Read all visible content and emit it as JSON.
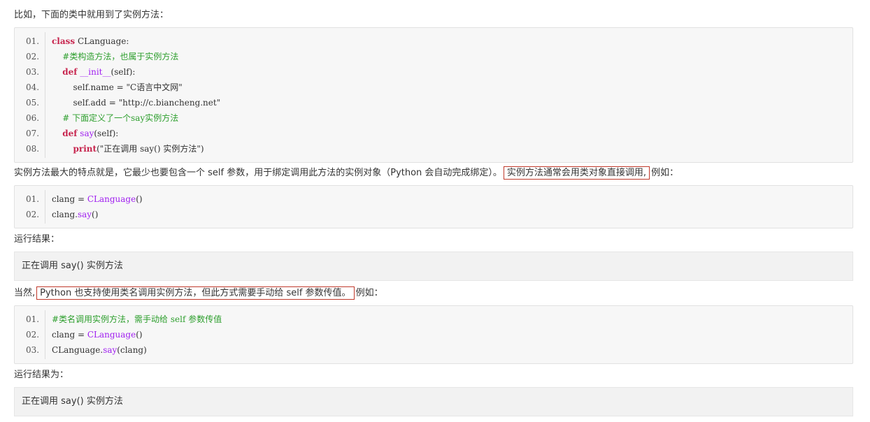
{
  "intro": "比如，下面的类中就用到了实例方法：",
  "code1": {
    "lines": [
      {
        "n": "01.",
        "parts": [
          [
            "kw",
            "class"
          ],
          [
            "plain",
            " CLanguage:"
          ]
        ]
      },
      {
        "n": "02.",
        "parts": [
          [
            "plain",
            "    "
          ],
          [
            "cm",
            "#类构造方法，也属于实例方法"
          ]
        ]
      },
      {
        "n": "03.",
        "parts": [
          [
            "plain",
            "    "
          ],
          [
            "kw",
            "def"
          ],
          [
            "plain",
            " "
          ],
          [
            "fn",
            "__init__"
          ],
          [
            "plain",
            "(self):"
          ]
        ]
      },
      {
        "n": "04.",
        "parts": [
          [
            "plain",
            "        self.name = \"C语言中文网\""
          ]
        ]
      },
      {
        "n": "05.",
        "parts": [
          [
            "plain",
            "        self.add = \"http://c.biancheng.net\""
          ]
        ]
      },
      {
        "n": "06.",
        "parts": [
          [
            "plain",
            "    "
          ],
          [
            "cm",
            "# 下面定义了一个say实例方法"
          ]
        ]
      },
      {
        "n": "07.",
        "parts": [
          [
            "plain",
            "    "
          ],
          [
            "kw",
            "def"
          ],
          [
            "plain",
            " "
          ],
          [
            "fn",
            "say"
          ],
          [
            "plain",
            "(self):"
          ]
        ]
      },
      {
        "n": "08.",
        "parts": [
          [
            "plain",
            "        "
          ],
          [
            "kw",
            "print"
          ],
          [
            "plain",
            "(\"正在调用 say() 实例方法\")"
          ]
        ]
      }
    ]
  },
  "para2": {
    "before": "实例方法最大的特点就是，它最少也要包含一个 self 参数，用于绑定调用此方法的实例对象（Python 会自动完成绑定）。",
    "highlight": "实例方法通常会用类对象直接调用,",
    "after": "例如："
  },
  "code2": {
    "lines": [
      {
        "n": "01.",
        "parts": [
          [
            "plain",
            "clang = "
          ],
          [
            "fn",
            "CLanguage"
          ],
          [
            "plain",
            "()"
          ]
        ]
      },
      {
        "n": "02.",
        "parts": [
          [
            "plain",
            "clang."
          ],
          [
            "fn",
            "say"
          ],
          [
            "plain",
            "()"
          ]
        ]
      }
    ]
  },
  "result_label1": "运行结果：",
  "result1": "正在调用 say() 实例方法",
  "para3": {
    "before": "当然,",
    "highlight": "Python 也支持使用类名调用实例方法，但此方式需要手动给 self 参数传值。",
    "after": "例如："
  },
  "code3": {
    "lines": [
      {
        "n": "01.",
        "parts": [
          [
            "cm",
            "#类名调用实例方法，需手动给 self 参数传值"
          ]
        ]
      },
      {
        "n": "02.",
        "parts": [
          [
            "plain",
            "clang = "
          ],
          [
            "fn",
            "CLanguage"
          ],
          [
            "plain",
            "()"
          ]
        ]
      },
      {
        "n": "03.",
        "parts": [
          [
            "plain",
            "CLanguage."
          ],
          [
            "fn",
            "say"
          ],
          [
            "plain",
            "(clang)"
          ]
        ]
      }
    ]
  },
  "result_label2": "运行结果为：",
  "result2": "正在调用 say() 实例方法",
  "colors": {
    "keyword": "#c7254e",
    "comment": "#2e9f2e",
    "function": "#a020f0",
    "highlight_border": "#c0392b"
  }
}
